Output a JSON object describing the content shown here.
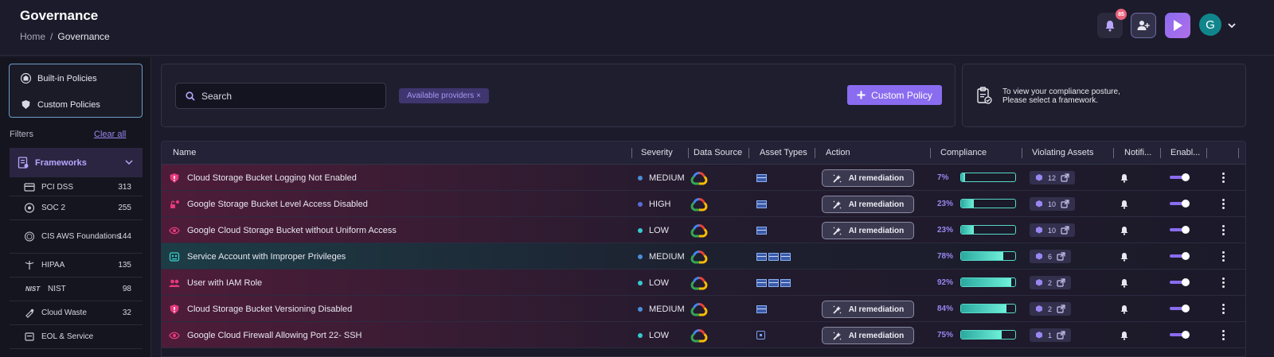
{
  "header": {
    "title": "Governance",
    "breadcrumb": [
      "Home",
      "/",
      "Governance"
    ],
    "notification_count": "85",
    "avatar_initial": "G"
  },
  "sidebar": {
    "policies": [
      {
        "label": "Built-in Policies",
        "icon": "building-icon"
      },
      {
        "label": "Custom Policies",
        "icon": "custom-shield-icon"
      }
    ],
    "filters_label": "Filters",
    "clear_all": "Clear all",
    "frameworks_label": "Frameworks",
    "frameworks": [
      {
        "label": "PCI DSS",
        "count": "313",
        "icon": "card-icon"
      },
      {
        "label": "SOC 2",
        "count": "255",
        "icon": "soc-icon"
      },
      {
        "label": "CIS AWS Foundations",
        "count": "144",
        "icon": "cis-icon"
      },
      {
        "label": "HIPAA",
        "count": "135",
        "icon": "caduceus-icon"
      },
      {
        "label": "NIST",
        "count": "98",
        "icon": "nist-logo",
        "mark": "NIST"
      },
      {
        "label": "Cloud Waste",
        "count": "32",
        "icon": "cloud-waste-icon"
      },
      {
        "label": "EOL & Service",
        "count": "",
        "icon": "eol-icon"
      }
    ]
  },
  "search": {
    "placeholder": "Search",
    "provider_chip": "Available providers ×",
    "custom_policy_label": "Custom Policy"
  },
  "compliance_notice": {
    "line1": "To view your compliance posture,",
    "line2": "Please select a framework."
  },
  "table": {
    "columns": [
      "Name",
      "Severity",
      "Data Source",
      "Asset Types",
      "Action",
      "Compliance",
      "Violating Assets",
      "Notifi...",
      "Enabl..."
    ],
    "ai_label": "AI remediation",
    "rows": [
      {
        "name": "Cloud Storage Bucket Logging Not Enabled",
        "severity": "MEDIUM",
        "assets": "bucket",
        "ai": true,
        "compliance": "7%",
        "fill": 0.07,
        "violating": "12",
        "tone": "red",
        "icon": "shield-alert-icon"
      },
      {
        "name": "Google Storage Bucket Level Access Disabled",
        "severity": "HIGH",
        "assets": "bucket",
        "ai": true,
        "compliance": "23%",
        "fill": 0.23,
        "violating": "10",
        "tone": "red",
        "icon": "access-icon"
      },
      {
        "name": "Google Cloud Storage Bucket without Uniform Access",
        "severity": "LOW",
        "assets": "bucket",
        "ai": true,
        "compliance": "23%",
        "fill": 0.23,
        "violating": "10",
        "tone": "red",
        "icon": "eye-icon"
      },
      {
        "name": "Service Account with Improper Privileges",
        "severity": "MEDIUM",
        "assets": "multi",
        "ai": false,
        "compliance": "78%",
        "fill": 0.78,
        "violating": "6",
        "tone": "teal",
        "icon": "service-account-icon"
      },
      {
        "name": "User with IAM Role",
        "severity": "LOW",
        "assets": "multi",
        "ai": false,
        "compliance": "92%",
        "fill": 0.92,
        "violating": "2",
        "tone": "red",
        "icon": "users-icon"
      },
      {
        "name": "Cloud Storage Bucket Versioning Disabled",
        "severity": "MEDIUM",
        "assets": "bucket",
        "ai": true,
        "compliance": "84%",
        "fill": 0.84,
        "violating": "2",
        "tone": "red",
        "icon": "shield-alert-icon"
      },
      {
        "name": "Google Cloud Firewall Allowing Port 22- SSH",
        "severity": "LOW",
        "assets": "chip",
        "ai": true,
        "compliance": "75%",
        "fill": 0.75,
        "violating": "1",
        "tone": "red",
        "icon": "eye-icon"
      }
    ]
  },
  "colors": {
    "accent": "#8a6cf0",
    "severity": {
      "HIGH": "#5b6cd6",
      "MEDIUM": "#4a8fd8",
      "LOW": "#38c8d0"
    }
  }
}
